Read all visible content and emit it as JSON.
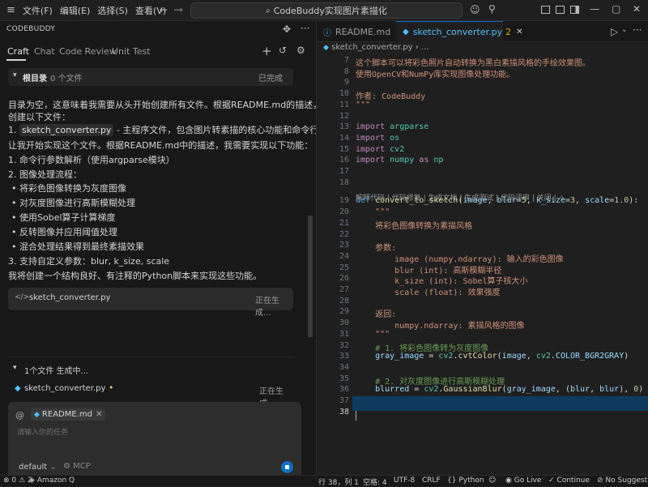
{
  "titlebar": {
    "menus": [
      "文件(F)",
      "编辑(E)",
      "选择(S)",
      "查看(V)"
    ],
    "more": "···",
    "title": "CodeBuddy实现图片素描化"
  },
  "left": {
    "header": "CODEBUDDY",
    "tabs": [
      "Craft",
      "Chat",
      "Code Review",
      "Unit Test"
    ],
    "root_label": "根目录",
    "root_count": "0 个文件",
    "root_status": "已完成",
    "messages": {
      "intro1": "目录为空，这意味着我需要从头开始创建所有文件。根据README.md的描述，我需要",
      "intro2": "创建以下文件：",
      "item1_num": "1.",
      "item1_file": "sketch_converter.py",
      "item1_desc": "- 主程序文件，包含图片转素描的核心功能和命令行接口",
      "line_plan": "让我开始实现这个文件。根据README.md中的描述，我需要实现以下功能：",
      "f1": "1. 命令行参数解析（使用argparse模块）",
      "f2": "2. 图像处理流程：",
      "b1": "将彩色图像转换为灰度图像",
      "b2": "对灰度图像进行高斯模糊处理",
      "b3": "使用Sobel算子计算梯度",
      "b4": "反转图像并应用阈值处理",
      "b5": "混合处理结果得到最终素描效果",
      "f3": "3. 支持自定义参数：blur, k_size, scale",
      "closing": "我将创建一个结构良好、有注释的Python脚本来实现这些功能。"
    },
    "gen_card": {
      "file": "sketch_converter.py",
      "status": "正在生成..."
    },
    "files_summary": "1个文件 生成中...",
    "file_row": {
      "file": "sketch_converter.py",
      "marker": "•",
      "status": "正在生成..."
    },
    "input": {
      "at": "@",
      "chip": "README.md",
      "placeholder": "请输入你的任务",
      "mode": "default",
      "mcp": "MCP"
    }
  },
  "editor": {
    "tabs": [
      {
        "label": "README.md"
      },
      {
        "label": "sketch_converter.py",
        "badge": "2"
      }
    ],
    "breadcrumb": "sketch_converter.py",
    "codelens": "解释代码 | 代码修复 | 生成文档 | 生成测试 | 代码评审 | 关闭 | ",
    "lines": [
      {
        "n": "7",
        "text": "这个脚本可以将彩色照片自动转换为黑白素描风格的手绘效果图。"
      },
      {
        "n": "8",
        "text": "使用OpenCV和NumPy库实现图像处理功能。"
      },
      {
        "n": "9",
        "text": ""
      },
      {
        "n": "10",
        "text": "作者: CodeBuddy"
      },
      {
        "n": "11",
        "text": "\"\"\""
      },
      {
        "n": "12",
        "text": ""
      },
      {
        "n": "13",
        "text": "import argparse"
      },
      {
        "n": "14",
        "text": "import os"
      },
      {
        "n": "15",
        "text": "import cv2"
      },
      {
        "n": "16",
        "text": "import numpy as np"
      },
      {
        "n": "17",
        "text": ""
      },
      {
        "n": "18",
        "text": ""
      },
      {
        "n": "19",
        "text": "def convert_to_sketch(image, blur=5, k_size=3, scale=1.0):"
      },
      {
        "n": "20",
        "text": "    \"\"\""
      },
      {
        "n": "21",
        "text": "    将彩色图像转换为素描风格"
      },
      {
        "n": "22",
        "text": ""
      },
      {
        "n": "23",
        "text": "    参数:"
      },
      {
        "n": "24",
        "text": "        image (numpy.ndarray): 输入的彩色图像"
      },
      {
        "n": "25",
        "text": "        blur (int): 高斯模糊半径"
      },
      {
        "n": "26",
        "text": "        k_size (int): Sobel算子核大小"
      },
      {
        "n": "27",
        "text": "        scale (float): 效果强度"
      },
      {
        "n": "28",
        "text": ""
      },
      {
        "n": "29",
        "text": "    返回:"
      },
      {
        "n": "30",
        "text": "        numpy.ndarray: 素描风格的图像"
      },
      {
        "n": "31",
        "text": "    \"\"\""
      },
      {
        "n": "32",
        "text": "    # 1. 将彩色图像转为灰度图像"
      },
      {
        "n": "33",
        "text": "    gray_image = cv2.cvtColor(image, cv2.COLOR_BGR2GRAY)"
      },
      {
        "n": "34",
        "text": ""
      },
      {
        "n": "35",
        "text": "    # 2. 对灰度图像进行高斯模糊处理"
      },
      {
        "n": "36",
        "text": "    blurred = cv2.GaussianBlur(gray_image, (blur, blur), 0)"
      },
      {
        "n": "37",
        "text": ""
      },
      {
        "n": "38",
        "text": ""
      }
    ]
  },
  "status": {
    "problems": "⊗ 0 ⚠ 2",
    "amazon": "Amazon Q",
    "position": "行 38，列 1",
    "spaces": "空格: 4",
    "encoding": "UTF-8",
    "eol": "CRLF",
    "language": "Python",
    "golive": "Go Live",
    "continue": "Continue",
    "suggestions": "No Suggestion"
  },
  "colors": {
    "accent": "#0e6fc2",
    "active_tab_text": "#4fc1ff",
    "selection": "#0f3a5e"
  }
}
